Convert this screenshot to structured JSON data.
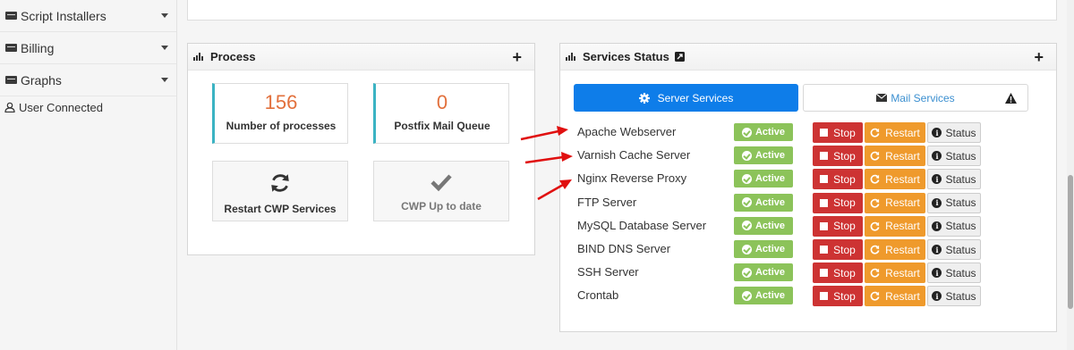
{
  "sidebar": {
    "items": [
      {
        "label": "Script Installers"
      },
      {
        "label": "Billing"
      },
      {
        "label": "Graphs"
      }
    ],
    "user_connected": "User Connected"
  },
  "process": {
    "title": "Process",
    "add": "+",
    "processes": {
      "value": "156",
      "label": "Number of processes"
    },
    "mail_queue": {
      "value": "0",
      "label": "Postfix Mail Queue"
    },
    "restart_cwp": {
      "label": "Restart CWP Services"
    },
    "cwp_status": {
      "label": "CWP Up to date"
    }
  },
  "services": {
    "title": "Services Status",
    "add": "+",
    "tabs": [
      {
        "label": "Server Services"
      },
      {
        "label": "Mail Services"
      }
    ],
    "state_label": "Active",
    "stop_label": "Stop",
    "restart_label": "Restart",
    "status_label": "Status",
    "rows": [
      {
        "name": "Apache Webserver"
      },
      {
        "name": "Varnish Cache Server"
      },
      {
        "name": "Nginx Reverse Proxy"
      },
      {
        "name": "FTP Server"
      },
      {
        "name": "MySQL Database Server"
      },
      {
        "name": "BIND DNS Server"
      },
      {
        "name": "SSH Server"
      },
      {
        "name": "Crontab"
      }
    ]
  },
  "colors": {
    "primary": "#0e7de9",
    "active": "#8cc35a",
    "stop": "#cd3333",
    "restart": "#ef9a2c",
    "accent_teal": "#3bb3c3",
    "number_orange": "#e2703c",
    "annotation_arrow": "#e01010"
  }
}
